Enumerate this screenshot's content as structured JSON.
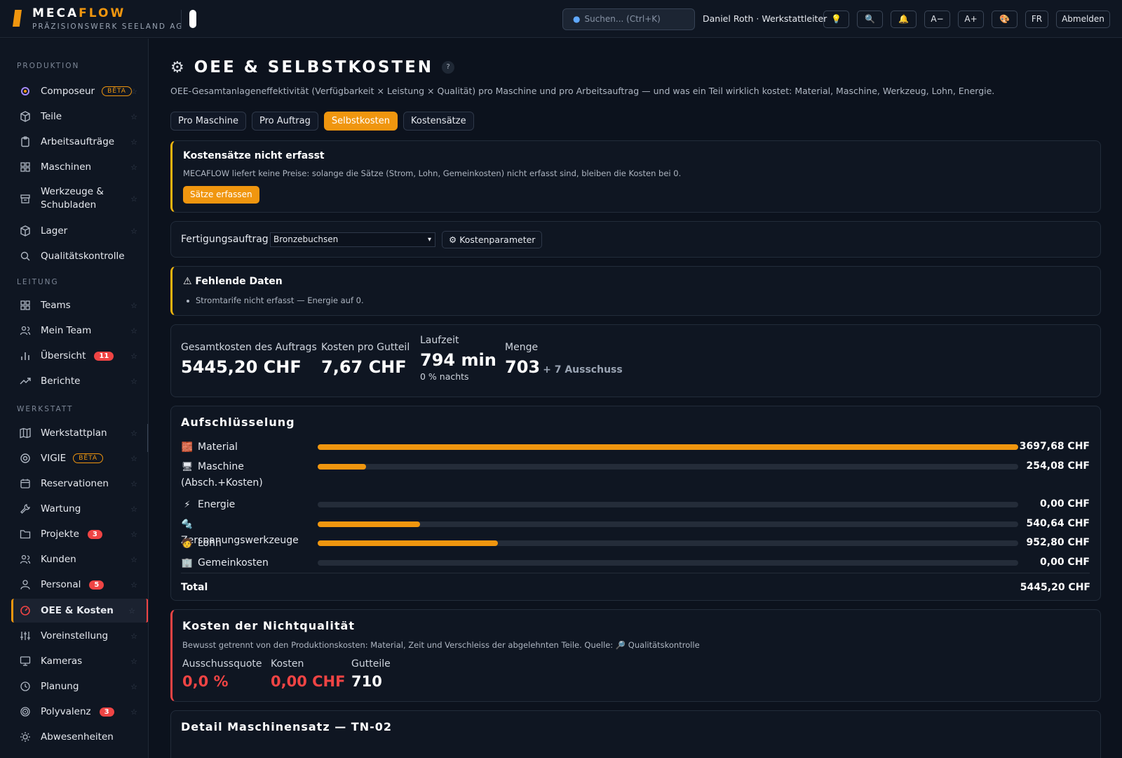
{
  "app": {
    "name_part1": "MECA",
    "name_part2": "FLOW",
    "company": "PRÄZISIONSWERK SEELAND AG",
    "accent_color": "#f0960f",
    "danger_color": "#ef4444"
  },
  "header": {
    "search_placeholder": "Suchen...  (Ctrl+K)",
    "search_icon": "search-icon",
    "user": "Daniel Roth · Werkstattleiter",
    "buttons": {
      "idea": "💡",
      "zoom": "🔍",
      "bell": "🔔",
      "font_smaller": "A−",
      "font_larger": "A+",
      "palette": "🎨",
      "lang": "FR",
      "logout": "Abmelden"
    }
  },
  "sidebar": {
    "sections": {
      "production": "PRODUKTION",
      "management": "LEITUNG",
      "workshop": "WERKSTATT"
    },
    "items": [
      {
        "label": "Composeur",
        "badge": "BÊTA",
        "icon": "compose-icon"
      },
      {
        "label": "Teile",
        "icon": "cube-icon"
      },
      {
        "label": "Arbeitsaufträge",
        "icon": "clipboard-icon"
      },
      {
        "label": "Maschinen",
        "icon": "grid-icon"
      },
      {
        "label": "Werkzeuge & Schubladen",
        "icon": "drawer-icon"
      },
      {
        "label": "Lager",
        "icon": "cube-icon"
      },
      {
        "label": "Qualitätskontrolle",
        "icon": "search-icon"
      },
      {
        "label": "Teams",
        "icon": "grid-icon"
      },
      {
        "label": "Mein Team",
        "icon": "users-icon"
      },
      {
        "label": "Übersicht",
        "badge": "11",
        "icon": "bar-chart-icon"
      },
      {
        "label": "Berichte",
        "icon": "trend-icon"
      },
      {
        "label": "Werkstattplan",
        "icon": "map-icon"
      },
      {
        "label": "VIGIE",
        "badge": "BÊTA",
        "icon": "target-icon"
      },
      {
        "label": "Reservationen",
        "icon": "calendar-icon"
      },
      {
        "label": "Wartung",
        "icon": "wrench-icon"
      },
      {
        "label": "Projekte",
        "badge": "3",
        "icon": "folder-icon"
      },
      {
        "label": "Kunden",
        "icon": "users-icon"
      },
      {
        "label": "Personal",
        "badge": "5",
        "icon": "user-icon"
      },
      {
        "label": "OEE & Kosten",
        "icon": "gauge-icon"
      },
      {
        "label": "Voreinstellung",
        "icon": "sliders-icon"
      },
      {
        "label": "Kameras",
        "icon": "monitor-icon"
      },
      {
        "label": "Planung",
        "icon": "clock-icon"
      },
      {
        "label": "Polyvalenz",
        "badge": "3",
        "icon": "target-icon"
      },
      {
        "label": "Abwesenheiten",
        "icon": "sun-icon"
      }
    ]
  },
  "page": {
    "title": "OEE & SELBSTKOSTEN",
    "help": "?",
    "subtitle": "OEE-Gesamtanlageneffektivität (Verfügbarkeit × Leistung × Qualität) pro Maschine und pro Arbeitsauftrag — und was ein Teil wirklich kostet: Material, Maschine, Werkzeug, Lohn, Energie.",
    "tabs": [
      {
        "label": "Pro Maschine"
      },
      {
        "label": "Pro Auftrag"
      },
      {
        "label": "Selbstkosten"
      },
      {
        "label": "Kostensätze"
      }
    ]
  },
  "rates_notice": {
    "title": "Kostensätze nicht erfasst",
    "text": "MECAFLOW liefert keine Preise: solange die Sätze (Strom, Lohn, Gemeinkosten) nicht erfasst sind, bleiben die Kosten bei 0.",
    "button": "Sätze erfassen"
  },
  "order_select": {
    "label": "Fertigungsauftrag",
    "value": "Bronzebuchsen",
    "params_button": "Kostenparameter"
  },
  "missing_data": {
    "title": "⚠ Fehlende Daten",
    "item": "Stromtarife nicht erfasst — Energie auf 0."
  },
  "kpis": {
    "total_label": "Gesamtkosten des Auftrags",
    "total_value": "5445,20 CHF",
    "per_part_label": "Kosten pro Gutteil",
    "per_part_value": "7,67 CHF",
    "runtime_label": "Laufzeit",
    "runtime_value": "794 min",
    "runtime_sub": "0 % nachts",
    "qty_label": "Menge",
    "qty_value": "703",
    "qty_scrap": "+ 7 Ausschuss"
  },
  "breakdown": {
    "title": "Aufschlüsselung",
    "rows": [
      {
        "icon": "🧱",
        "label": "Material",
        "fraction": 1.0,
        "amount": "3697,68 CHF"
      },
      {
        "icon": "🖥",
        "label": "Maschine (Absch.+Kosten)",
        "fraction": 0.0687,
        "amount": "254,08 CHF"
      },
      {
        "icon": "⚡",
        "label": "Energie",
        "fraction": 0,
        "amount": "0,00 CHF"
      },
      {
        "icon": "🔩",
        "label": "Zerspanungswerkzeuge",
        "fraction": 0.1462,
        "amount": "540,64 CHF"
      },
      {
        "icon": "🧑",
        "label": "Lohn",
        "fraction": 0.2577,
        "amount": "952,80 CHF"
      },
      {
        "icon": "🏢",
        "label": "Gemeinkosten",
        "fraction": 0,
        "amount": "0,00 CHF"
      }
    ],
    "total_label": "Total",
    "total_value": "5445,20 CHF"
  },
  "nonquality": {
    "title": "Kosten der Nichtqualität",
    "text": "Bewusst getrennt von den Produktionskosten: Material, Zeit und Verschleiss der abgelehnten Teile. Quelle: 🔎 Qualitätskontrolle",
    "scrap_rate_label": "Ausschussquote",
    "scrap_rate_value": "0,0 %",
    "cost_label": "Kosten",
    "cost_value": "0,00 CHF",
    "good_label": "Gutteile",
    "good_value": "710"
  },
  "machine_detail": {
    "title": "Detail Maschinensatz — TN-02"
  }
}
